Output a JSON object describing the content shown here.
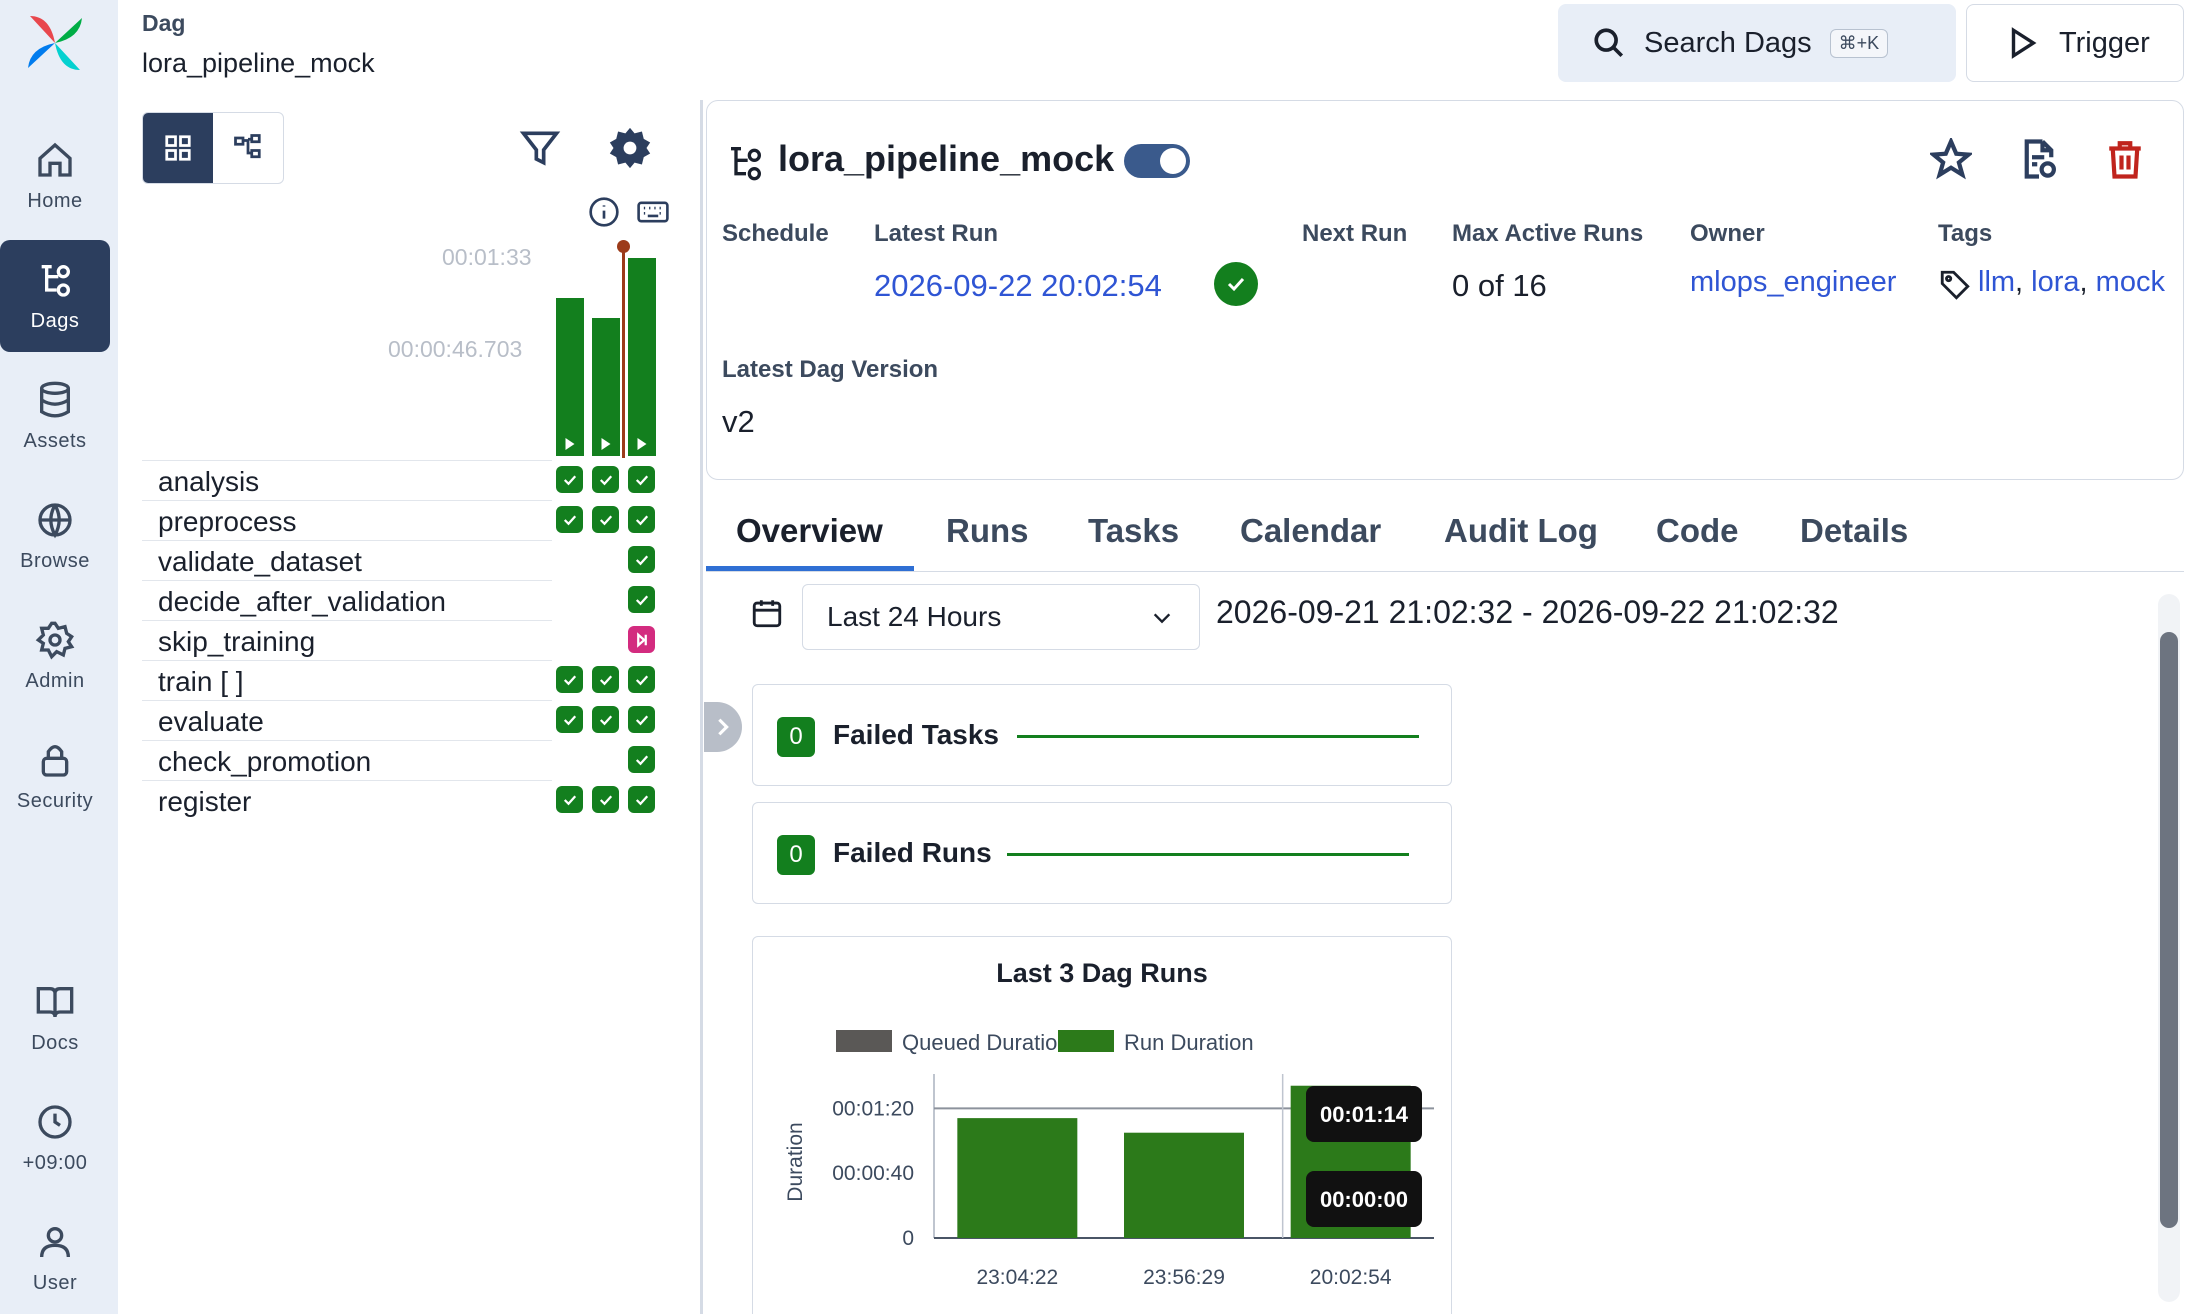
{
  "nav": {
    "items": [
      {
        "label": "Home",
        "icon": "home-icon"
      },
      {
        "label": "Dags",
        "icon": "dags-icon"
      },
      {
        "label": "Assets",
        "icon": "database-icon"
      },
      {
        "label": "Browse",
        "icon": "globe-icon"
      },
      {
        "label": "Admin",
        "icon": "gear-icon"
      },
      {
        "label": "Security",
        "icon": "lock-icon"
      },
      {
        "label": "Docs",
        "icon": "book-icon"
      },
      {
        "label": "+09:00",
        "icon": "clock-icon"
      },
      {
        "label": "User",
        "icon": "user-icon"
      }
    ],
    "active": "Dags"
  },
  "breadcrumb": {
    "section": "Dag",
    "name": "lora_pipeline_mock"
  },
  "search": {
    "label": "Search Dags",
    "shortcut": "⌘+K"
  },
  "trigger": {
    "label": "Trigger"
  },
  "grid": {
    "duration_max": "00:01:33",
    "duration_mid": "00:00:46.703",
    "tasks": [
      {
        "name": "analysis",
        "states": [
          "success",
          "success",
          "success"
        ]
      },
      {
        "name": "preprocess",
        "states": [
          "success",
          "success",
          "success"
        ]
      },
      {
        "name": "validate_dataset",
        "states": [
          "",
          "",
          "success"
        ]
      },
      {
        "name": "decide_after_validation",
        "states": [
          "",
          "",
          "success"
        ]
      },
      {
        "name": "skip_training",
        "states": [
          "",
          "",
          "skipped"
        ]
      },
      {
        "name": "train [ ]",
        "states": [
          "success",
          "success",
          "success"
        ]
      },
      {
        "name": "evaluate",
        "states": [
          "success",
          "success",
          "success"
        ]
      },
      {
        "name": "check_promotion",
        "states": [
          "",
          "",
          "success"
        ]
      },
      {
        "name": "register",
        "states": [
          "success",
          "success",
          "success"
        ]
      }
    ],
    "run_durations": [
      74,
      65,
      93
    ]
  },
  "dag": {
    "title": "lora_pipeline_mock",
    "paused": false,
    "labels": {
      "schedule": "Schedule",
      "latest_run": "Latest Run",
      "next_run": "Next Run",
      "max_active_runs": "Max Active Runs",
      "owner": "Owner",
      "tags": "Tags",
      "latest_version": "Latest Dag Version"
    },
    "latest_run": "2026-09-22 20:02:54",
    "max_active_runs": "0 of 16",
    "owner": "mlops_engineer",
    "tags": [
      "llm",
      "lora",
      "mock"
    ],
    "tag_sep": ",",
    "latest_version": "v2"
  },
  "tabs": [
    "Overview",
    "Runs",
    "Tasks",
    "Calendar",
    "Audit Log",
    "Code",
    "Details"
  ],
  "active_tab": "Overview",
  "filter": {
    "range_select": "Last 24 Hours",
    "range_text": "2026-09-21 21:02:32 - 2026-09-22 21:02:32"
  },
  "stats": [
    {
      "count": "0",
      "label": "Failed Tasks"
    },
    {
      "count": "0",
      "label": "Failed Runs"
    }
  ],
  "chart_data": {
    "type": "bar",
    "title": "Last 3 Dag Runs",
    "ylabel": "Duration",
    "categories": [
      "23:04:22",
      "23:56:29",
      "20:02:54"
    ],
    "series": [
      {
        "name": "Queued Duration",
        "values": [
          0,
          0,
          0
        ]
      },
      {
        "name": "Run Duration",
        "values": [
          74,
          65,
          94
        ]
      }
    ],
    "y_ticks": [
      "0",
      "00:00:40",
      "00:01:20"
    ],
    "y_tick_values": [
      0,
      40,
      80
    ],
    "ylim": [
      0,
      100
    ],
    "colors": {
      "queued": "#5a5856",
      "run": "#2c7a1a"
    },
    "reference_value": 80,
    "tooltips": [
      "00:01:14",
      "00:00:00"
    ]
  }
}
